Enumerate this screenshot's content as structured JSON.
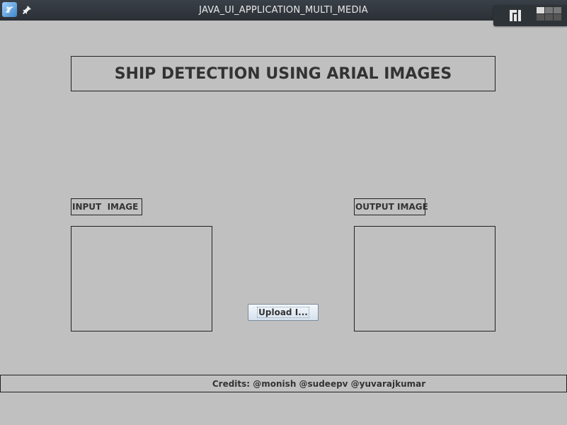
{
  "window": {
    "title": "JAVA_UI_APPLICATION_MULTI_MEDIA",
    "app_icon": "java-app-icon",
    "pin_icon": "pin-icon",
    "tray_icon": "manjaro-logo-icon",
    "workspaces": 6
  },
  "header": {
    "title": "SHIP DETECTION USING ARIAL IMAGES"
  },
  "panels": {
    "input_label": "INPUT  IMAGE",
    "output_label": "OUTPUT IMAGE"
  },
  "actions": {
    "upload_label": "Upload I..."
  },
  "footer": {
    "credits": "Credits: @monish @sudeepv @yuvarajkumar"
  },
  "colors": {
    "background": "#c0c0c0",
    "titlebar": "#2f343a",
    "border": "#222222",
    "text": "#333333"
  }
}
